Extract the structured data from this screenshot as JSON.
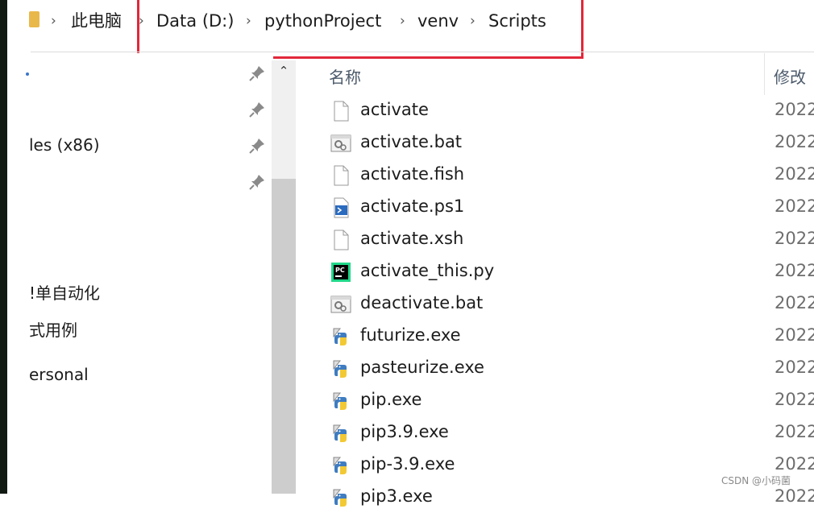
{
  "breadcrumb": {
    "items": [
      "此电脑",
      "Data (D:)",
      "pythonProject",
      "venv",
      "Scripts"
    ]
  },
  "nav": {
    "items": [
      "les (x86)",
      "!单自动化",
      "式用例",
      "ersonal"
    ]
  },
  "columns": {
    "name": "名称",
    "modified": "修改"
  },
  "files": [
    {
      "name": "activate",
      "icon": "blank-file-icon",
      "date": "2022"
    },
    {
      "name": "activate.bat",
      "icon": "batch-file-icon",
      "date": "2022"
    },
    {
      "name": "activate.fish",
      "icon": "blank-file-icon",
      "date": "2022"
    },
    {
      "name": "activate.ps1",
      "icon": "powershell-file-icon",
      "date": "2022"
    },
    {
      "name": "activate.xsh",
      "icon": "blank-file-icon",
      "date": "2022"
    },
    {
      "name": "activate_this.py",
      "icon": "pycharm-file-icon",
      "date": "2022"
    },
    {
      "name": "deactivate.bat",
      "icon": "batch-file-icon",
      "date": "2022"
    },
    {
      "name": "futurize.exe",
      "icon": "python-exe-icon",
      "date": "2022"
    },
    {
      "name": "pasteurize.exe",
      "icon": "python-exe-icon",
      "date": "2022"
    },
    {
      "name": "pip.exe",
      "icon": "python-exe-icon",
      "date": "2022"
    },
    {
      "name": "pip3.9.exe",
      "icon": "python-exe-icon",
      "date": "2022"
    },
    {
      "name": "pip-3.9.exe",
      "icon": "python-exe-icon",
      "date": "2022"
    },
    {
      "name": "pip3.exe",
      "icon": "python-exe-icon",
      "date": "2022"
    }
  ],
  "colors": {
    "highlight": "#e1283a",
    "folder": "#e9b84a",
    "scrollbar": "#cdcdcd"
  },
  "watermark": "CSDN @小码菌"
}
